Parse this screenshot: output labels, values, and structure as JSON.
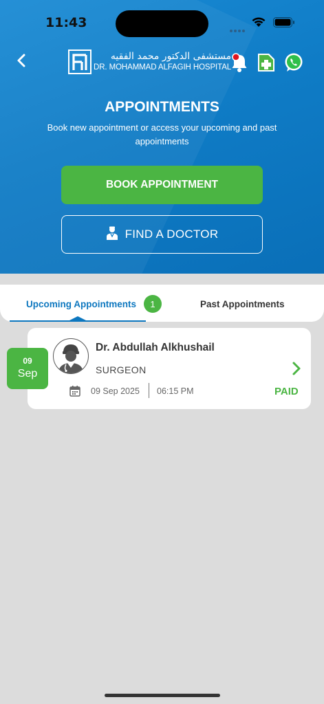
{
  "status_bar": {
    "time": "11:43",
    "signal_icon": "signal-dots-icon",
    "wifi_icon": "wifi-icon",
    "battery_icon": "battery-icon"
  },
  "header": {
    "back_icon": "chevron-left-icon",
    "logo": {
      "arabic": "مستشفى الدكتور محمد الفقيه",
      "english": "DR. MOHAMMAD ALFAGIH HOSPITAL"
    },
    "icons": [
      "bell-icon",
      "medical-record-icon",
      "whatsapp-icon"
    ]
  },
  "hero": {
    "title": "APPOINTMENTS",
    "subtitle": "Book new appointment or access your upcoming and past appointments",
    "book_button": "BOOK APPOINTMENT",
    "find_button": "FIND A DOCTOR"
  },
  "tabs": {
    "upcoming": "Upcoming Appointments",
    "upcoming_count": "1",
    "past": "Past Appointments",
    "active": "upcoming"
  },
  "appointments": [
    {
      "day": "09",
      "month": "Sep",
      "doctor": "Dr. Abdullah Alkhushail",
      "specialty": "SURGEON",
      "date": "09 Sep 2025",
      "time": "06:15 PM",
      "status": "PAID"
    }
  ],
  "colors": {
    "primary_blue": "#0f7cc6",
    "accent_green": "#4bb543",
    "background": "#dcdcdc"
  }
}
